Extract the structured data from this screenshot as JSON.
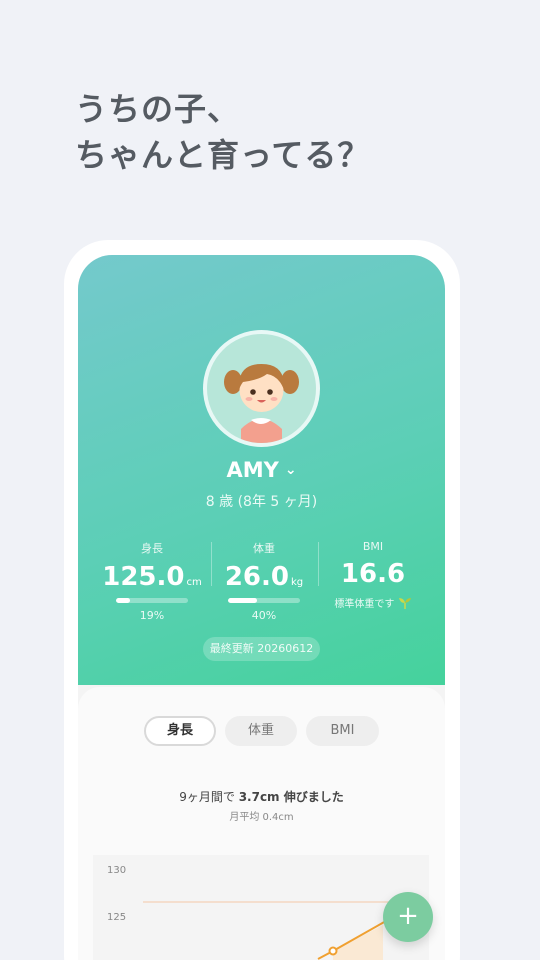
{
  "headline": {
    "line1": "うちの子、",
    "line2": "ちゃんと育ってる？"
  },
  "profile": {
    "name": "AMY",
    "age": "8 歳 (8年 5 ヶ月)"
  },
  "stats": {
    "height": {
      "label": "身長",
      "value": "125.0",
      "unit": "cm",
      "percent_text": "19%",
      "percent": 0.19
    },
    "weight": {
      "label": "体重",
      "value": "26.0",
      "unit": "kg",
      "percent_text": "40%",
      "percent": 0.4
    },
    "bmi": {
      "label": "BMI",
      "value": "16.6",
      "note": "標準体重です"
    }
  },
  "updated": "最終更新 20260612",
  "tabs": [
    "身長",
    "体重",
    "BMI"
  ],
  "active_tab": "身長",
  "summary": {
    "prefix": "9ヶ月間で ",
    "highlight": "3.7cm 伸びました",
    "avg": "月平均 0.4cm"
  },
  "chart_data": {
    "type": "line",
    "y_ticks": [
      "130",
      "125"
    ],
    "reference_y": 125
  },
  "fab_label": "+",
  "colors": {
    "accent": "#45d29c",
    "line": "#f0a030",
    "fab": "#7ccca0"
  }
}
